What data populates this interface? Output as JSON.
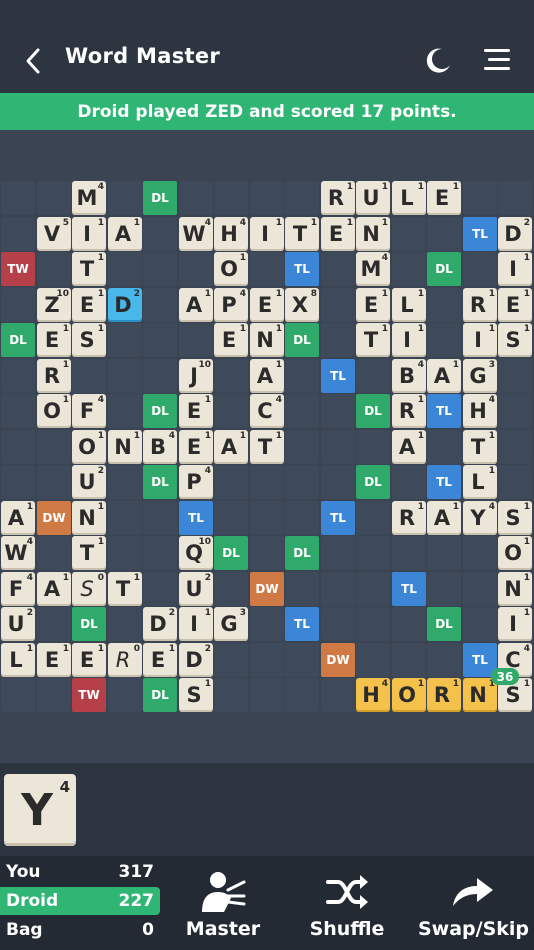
{
  "header": {
    "title": "Word Master",
    "back_icon": "back-arrow-icon",
    "theme_icon": "moon-icon",
    "menu_icon": "hamburger-menu-icon"
  },
  "banner": {
    "text": "Droid played ZED and scored 17 points.",
    "color": "#2fb675"
  },
  "board": {
    "size": 15,
    "bonuses": [
      {
        "r": 0,
        "c": 4,
        "t": "DL"
      },
      {
        "r": 1,
        "c": 13,
        "t": "TL"
      },
      {
        "r": 2,
        "c": 0,
        "t": "TW"
      },
      {
        "r": 2,
        "c": 8,
        "t": "TL"
      },
      {
        "r": 2,
        "c": 12,
        "t": "DL"
      },
      {
        "r": 4,
        "c": 0,
        "t": "DL"
      },
      {
        "r": 4,
        "c": 8,
        "t": "DL"
      },
      {
        "r": 5,
        "c": 9,
        "t": "TL"
      },
      {
        "r": 6,
        "c": 4,
        "t": "DL"
      },
      {
        "r": 6,
        "c": 10,
        "t": "DL"
      },
      {
        "r": 6,
        "c": 12,
        "t": "TL"
      },
      {
        "r": 8,
        "c": 4,
        "t": "DL"
      },
      {
        "r": 8,
        "c": 10,
        "t": "DL"
      },
      {
        "r": 8,
        "c": 12,
        "t": "TL"
      },
      {
        "r": 9,
        "c": 1,
        "t": "DW"
      },
      {
        "r": 9,
        "c": 5,
        "t": "TL"
      },
      {
        "r": 9,
        "c": 9,
        "t": "TL"
      },
      {
        "r": 10,
        "c": 6,
        "t": "DL"
      },
      {
        "r": 10,
        "c": 8,
        "t": "DL"
      },
      {
        "r": 11,
        "c": 7,
        "t": "DW"
      },
      {
        "r": 11,
        "c": 11,
        "t": "TL"
      },
      {
        "r": 12,
        "c": 2,
        "t": "DL"
      },
      {
        "r": 12,
        "c": 8,
        "t": "TL"
      },
      {
        "r": 12,
        "c": 12,
        "t": "DL"
      },
      {
        "r": 13,
        "c": 9,
        "t": "DW"
      },
      {
        "r": 13,
        "c": 13,
        "t": "TL"
      },
      {
        "r": 14,
        "c": 2,
        "t": "TW"
      },
      {
        "r": 14,
        "c": 4,
        "t": "DL"
      }
    ],
    "tiles": [
      {
        "r": 0,
        "c": 2,
        "l": "M",
        "v": "4"
      },
      {
        "r": 0,
        "c": 9,
        "l": "R",
        "v": "1"
      },
      {
        "r": 0,
        "c": 10,
        "l": "U",
        "v": "1"
      },
      {
        "r": 0,
        "c": 11,
        "l": "L",
        "v": "1"
      },
      {
        "r": 0,
        "c": 12,
        "l": "E",
        "v": "1"
      },
      {
        "r": 1,
        "c": 1,
        "l": "V",
        "v": "5"
      },
      {
        "r": 1,
        "c": 2,
        "l": "I",
        "v": "1"
      },
      {
        "r": 1,
        "c": 3,
        "l": "A",
        "v": "1"
      },
      {
        "r": 1,
        "c": 5,
        "l": "W",
        "v": "4"
      },
      {
        "r": 1,
        "c": 6,
        "l": "H",
        "v": "4"
      },
      {
        "r": 1,
        "c": 7,
        "l": "I",
        "v": "1"
      },
      {
        "r": 1,
        "c": 8,
        "l": "T",
        "v": "1"
      },
      {
        "r": 1,
        "c": 9,
        "l": "E",
        "v": "1"
      },
      {
        "r": 1,
        "c": 10,
        "l": "N",
        "v": "1"
      },
      {
        "r": 1,
        "c": 14,
        "l": "D",
        "v": "2"
      },
      {
        "r": 2,
        "c": 2,
        "l": "T",
        "v": "1"
      },
      {
        "r": 2,
        "c": 6,
        "l": "O",
        "v": "1"
      },
      {
        "r": 2,
        "c": 10,
        "l": "M",
        "v": "4"
      },
      {
        "r": 2,
        "c": 14,
        "l": "I",
        "v": "1"
      },
      {
        "r": 3,
        "c": 1,
        "l": "Z",
        "v": "10"
      },
      {
        "r": 3,
        "c": 2,
        "l": "E",
        "v": "1"
      },
      {
        "r": 3,
        "c": 3,
        "l": "D",
        "v": "2",
        "s": "blue"
      },
      {
        "r": 3,
        "c": 5,
        "l": "A",
        "v": "1"
      },
      {
        "r": 3,
        "c": 6,
        "l": "P",
        "v": "4"
      },
      {
        "r": 3,
        "c": 7,
        "l": "E",
        "v": "1"
      },
      {
        "r": 3,
        "c": 8,
        "l": "X",
        "v": "8"
      },
      {
        "r": 3,
        "c": 10,
        "l": "E",
        "v": "1"
      },
      {
        "r": 3,
        "c": 11,
        "l": "L",
        "v": "1"
      },
      {
        "r": 3,
        "c": 13,
        "l": "R",
        "v": "1"
      },
      {
        "r": 3,
        "c": 14,
        "l": "E",
        "v": "1"
      },
      {
        "r": 4,
        "c": 1,
        "l": "E",
        "v": "1"
      },
      {
        "r": 4,
        "c": 2,
        "l": "S",
        "v": "1"
      },
      {
        "r": 4,
        "c": 6,
        "l": "E",
        "v": "1"
      },
      {
        "r": 4,
        "c": 7,
        "l": "N",
        "v": "1"
      },
      {
        "r": 4,
        "c": 10,
        "l": "T",
        "v": "1"
      },
      {
        "r": 4,
        "c": 11,
        "l": "I",
        "v": "1"
      },
      {
        "r": 4,
        "c": 13,
        "l": "I",
        "v": "1"
      },
      {
        "r": 4,
        "c": 14,
        "l": "S",
        "v": "1"
      },
      {
        "r": 5,
        "c": 1,
        "l": "R",
        "v": "1"
      },
      {
        "r": 5,
        "c": 5,
        "l": "J",
        "v": "10"
      },
      {
        "r": 5,
        "c": 7,
        "l": "A",
        "v": "1"
      },
      {
        "r": 5,
        "c": 11,
        "l": "B",
        "v": "4"
      },
      {
        "r": 5,
        "c": 12,
        "l": "A",
        "v": "1"
      },
      {
        "r": 5,
        "c": 13,
        "l": "G",
        "v": "3"
      },
      {
        "r": 6,
        "c": 1,
        "l": "O",
        "v": "1"
      },
      {
        "r": 6,
        "c": 2,
        "l": "F",
        "v": "4"
      },
      {
        "r": 6,
        "c": 5,
        "l": "E",
        "v": "1"
      },
      {
        "r": 6,
        "c": 7,
        "l": "C",
        "v": "4"
      },
      {
        "r": 6,
        "c": 11,
        "l": "R",
        "v": "1"
      },
      {
        "r": 6,
        "c": 13,
        "l": "H",
        "v": "4"
      },
      {
        "r": 7,
        "c": 2,
        "l": "O",
        "v": "1"
      },
      {
        "r": 7,
        "c": 3,
        "l": "N",
        "v": "1"
      },
      {
        "r": 7,
        "c": 4,
        "l": "B",
        "v": "4"
      },
      {
        "r": 7,
        "c": 5,
        "l": "E",
        "v": "1"
      },
      {
        "r": 7,
        "c": 6,
        "l": "A",
        "v": "1"
      },
      {
        "r": 7,
        "c": 7,
        "l": "T",
        "v": "1"
      },
      {
        "r": 7,
        "c": 11,
        "l": "A",
        "v": "1"
      },
      {
        "r": 7,
        "c": 13,
        "l": "T",
        "v": "1"
      },
      {
        "r": 8,
        "c": 2,
        "l": "U",
        "v": "2"
      },
      {
        "r": 8,
        "c": 5,
        "l": "P",
        "v": "4"
      },
      {
        "r": 8,
        "c": 13,
        "l": "L",
        "v": "1"
      },
      {
        "r": 9,
        "c": 0,
        "l": "A",
        "v": "1"
      },
      {
        "r": 9,
        "c": 2,
        "l": "N",
        "v": "1"
      },
      {
        "r": 9,
        "c": 11,
        "l": "R",
        "v": "1"
      },
      {
        "r": 9,
        "c": 12,
        "l": "A",
        "v": "1"
      },
      {
        "r": 9,
        "c": 13,
        "l": "Y",
        "v": "4"
      },
      {
        "r": 9,
        "c": 14,
        "l": "S",
        "v": "1"
      },
      {
        "r": 10,
        "c": 0,
        "l": "W",
        "v": "4"
      },
      {
        "r": 10,
        "c": 2,
        "l": "T",
        "v": "1"
      },
      {
        "r": 10,
        "c": 5,
        "l": "Q",
        "v": "10"
      },
      {
        "r": 10,
        "c": 14,
        "l": "O",
        "v": "1"
      },
      {
        "r": 11,
        "c": 0,
        "l": "F",
        "v": "4"
      },
      {
        "r": 11,
        "c": 1,
        "l": "A",
        "v": "1"
      },
      {
        "r": 11,
        "c": 2,
        "l": "S",
        "v": "0",
        "blank": true
      },
      {
        "r": 11,
        "c": 3,
        "l": "T",
        "v": "1"
      },
      {
        "r": 11,
        "c": 5,
        "l": "U",
        "v": "2"
      },
      {
        "r": 11,
        "c": 14,
        "l": "N",
        "v": "1"
      },
      {
        "r": 12,
        "c": 0,
        "l": "U",
        "v": "2"
      },
      {
        "r": 12,
        "c": 4,
        "l": "D",
        "v": "2"
      },
      {
        "r": 12,
        "c": 5,
        "l": "I",
        "v": "1"
      },
      {
        "r": 12,
        "c": 6,
        "l": "G",
        "v": "3"
      },
      {
        "r": 12,
        "c": 14,
        "l": "I",
        "v": "1"
      },
      {
        "r": 13,
        "c": 0,
        "l": "L",
        "v": "1"
      },
      {
        "r": 13,
        "c": 1,
        "l": "E",
        "v": "1"
      },
      {
        "r": 13,
        "c": 2,
        "l": "E",
        "v": "1"
      },
      {
        "r": 13,
        "c": 3,
        "l": "R",
        "v": "0",
        "blank": true
      },
      {
        "r": 13,
        "c": 4,
        "l": "E",
        "v": "1"
      },
      {
        "r": 13,
        "c": 5,
        "l": "D",
        "v": "2"
      },
      {
        "r": 13,
        "c": 14,
        "l": "C",
        "v": "4"
      },
      {
        "r": 14,
        "c": 5,
        "l": "S",
        "v": "1"
      },
      {
        "r": 14,
        "c": 10,
        "l": "H",
        "v": "4",
        "s": "last"
      },
      {
        "r": 14,
        "c": 11,
        "l": "O",
        "v": "1",
        "s": "last"
      },
      {
        "r": 14,
        "c": 12,
        "l": "R",
        "v": "1",
        "s": "last"
      },
      {
        "r": 14,
        "c": 13,
        "l": "N",
        "v": "1",
        "s": "last"
      },
      {
        "r": 14,
        "c": 14,
        "l": "S",
        "v": "1"
      }
    ],
    "move_score_badge": "36"
  },
  "rack": [
    {
      "letter": "Y",
      "value": "4"
    }
  ],
  "scores": [
    {
      "name": "You",
      "score": "317",
      "active": false
    },
    {
      "name": "Droid",
      "score": "227",
      "active": true
    },
    {
      "name": "Bag",
      "score": "0",
      "active": false
    }
  ],
  "actions": [
    {
      "label": "Master",
      "icon": "master-person-icon"
    },
    {
      "label": "Shuffle",
      "icon": "shuffle-icon"
    },
    {
      "label": "Swap/Skip",
      "icon": "share-arrow-icon"
    }
  ],
  "colors": {
    "DL": "#2faa6b",
    "TL": "#3b86d6",
    "DW": "#cf7a45",
    "TW": "#b5404a",
    "tile": "#ece6d8",
    "last_move": "#f4c24b",
    "accent": "#2fb675"
  }
}
